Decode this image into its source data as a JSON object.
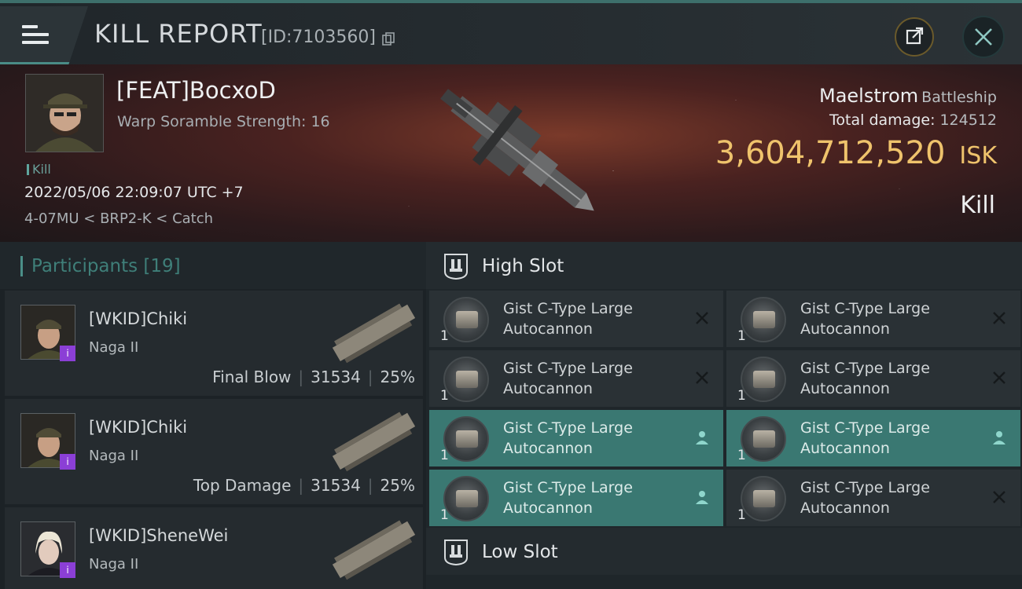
{
  "header": {
    "title": "KILL REPORT",
    "report_id": "[ID:7103560]"
  },
  "victim": {
    "name": "[FEAT]BocxoD",
    "warp_scramble": "Warp Soramble Strength: 16",
    "tag": "Kill",
    "timestamp": "2022/05/06 22:09:07 UTC +7",
    "location": "4-07MU < BRP2-K < Catch"
  },
  "ship": {
    "name": "Maelstrom",
    "class": "Battleship",
    "total_damage_label": "Total damage:",
    "total_damage": "124512",
    "isk_value": "3,604,712,520",
    "isk_unit": "ISK",
    "result": "Kill"
  },
  "participants": {
    "title": "Participants",
    "count": "[19]",
    "items": [
      {
        "name": "[WKID]Chiki",
        "ship": "Naga II",
        "role": "Final Blow",
        "damage": "31534",
        "percent": "25%",
        "badge": "i"
      },
      {
        "name": "[WKID]Chiki",
        "ship": "Naga II",
        "role": "Top Damage",
        "damage": "31534",
        "percent": "25%",
        "badge": "i"
      },
      {
        "name": "[WKID]SheneWei",
        "ship": "Naga II",
        "role": "",
        "damage": "",
        "percent": "",
        "badge": "i"
      }
    ]
  },
  "high_slot": {
    "title": "High Slot",
    "modules": [
      {
        "line1": "Gist C-Type Large",
        "line2": "Autocannon",
        "qty": "1",
        "state": "destroyed"
      },
      {
        "line1": "Gist C-Type Large",
        "line2": "Autocannon",
        "qty": "1",
        "state": "destroyed"
      },
      {
        "line1": "Gist C-Type Large",
        "line2": "Autocannon",
        "qty": "1",
        "state": "destroyed"
      },
      {
        "line1": "Gist C-Type Large",
        "line2": "Autocannon",
        "qty": "1",
        "state": "destroyed"
      },
      {
        "line1": "Gist C-Type Large",
        "line2": "Autocannon",
        "qty": "1",
        "state": "dropped"
      },
      {
        "line1": "Gist C-Type Large",
        "line2": "Autocannon",
        "qty": "1",
        "state": "dropped"
      },
      {
        "line1": "Gist C-Type Large",
        "line2": "Autocannon",
        "qty": "1",
        "state": "dropped"
      },
      {
        "line1": "Gist C-Type Large",
        "line2": "Autocannon",
        "qty": "1",
        "state": "destroyed"
      }
    ]
  },
  "low_slot": {
    "title": "Low Slot"
  },
  "icons": {
    "menu": "menu-icon",
    "copy": "copy-icon",
    "share": "share-icon",
    "close": "close-icon",
    "slot": "turret-slot-icon",
    "destroyed": "x-icon",
    "dropped": "person-icon"
  },
  "colors": {
    "accent": "#4b8f88",
    "isk": "#efc36c",
    "highlight": "#3a7872"
  }
}
